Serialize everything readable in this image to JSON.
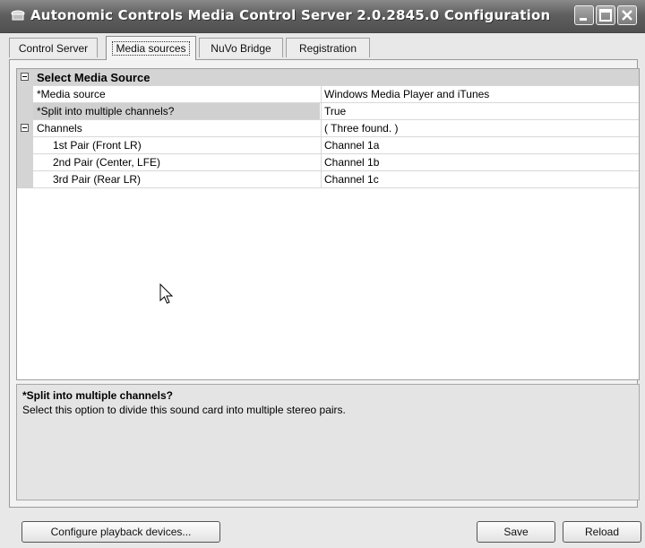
{
  "window": {
    "title": "Autonomic Controls Media Control Server 2.0.2845.0 Configuration"
  },
  "tabs": [
    {
      "label": "Control Server",
      "active": false
    },
    {
      "label": "Media sources",
      "active": true
    },
    {
      "label": "NuVo Bridge",
      "active": false
    },
    {
      "label": "Registration",
      "active": false
    }
  ],
  "property_grid": {
    "category": "Select Media Source",
    "rows": [
      {
        "name": "*Media source",
        "value": "Windows Media Player and iTunes"
      },
      {
        "name": "*Split into multiple channels?",
        "value": "True",
        "selected": true
      },
      {
        "name": "Channels",
        "value": "( Three found. )",
        "expandable": true
      },
      {
        "name": "1st Pair (Front LR)",
        "value": "Channel 1a"
      },
      {
        "name": "2nd Pair (Center, LFE)",
        "value": "Channel 1b"
      },
      {
        "name": "3rd Pair (Rear LR)",
        "value": "Channel 1c"
      }
    ]
  },
  "description": {
    "title": "*Split into multiple channels?",
    "text": "Select this option to divide this sound card into multiple stereo pairs."
  },
  "buttons": {
    "configure": "Configure playback devices...",
    "save": "Save",
    "reload": "Reload"
  },
  "icons": {
    "app": "app-icon",
    "minimize": "minimize-icon",
    "maximize": "maximize-icon",
    "close": "close-icon",
    "cursor": "mouse-cursor-icon"
  }
}
